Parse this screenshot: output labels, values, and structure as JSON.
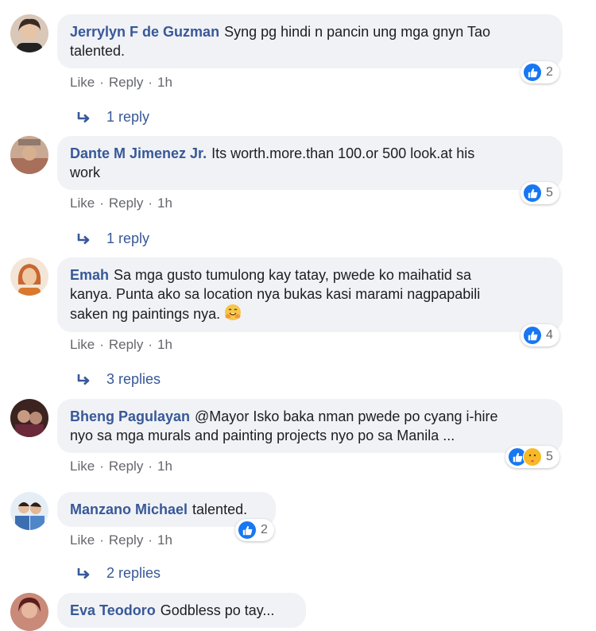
{
  "actions": {
    "like": "Like",
    "reply": "Reply",
    "sep": "·"
  },
  "colors": {
    "name": "#385898",
    "like_blue": "#1877f2",
    "bubble_bg": "#f0f2f5",
    "meta_gray": "#65676b"
  },
  "comments": [
    {
      "author": "Jerrylyn F de Guzman",
      "text_lines": [
        "Syng pg hindi n pancin ung mga gnyn Tao",
        "talented."
      ],
      "time": "1h",
      "reactions": {
        "types": [
          "like"
        ],
        "count": "2"
      },
      "replies": "1 reply"
    },
    {
      "author": "Dante M Jimenez Jr.",
      "text_lines": [
        "Its worth.more.than 100.or 500 look.at his",
        "work"
      ],
      "time": "1h",
      "reactions": {
        "types": [
          "like"
        ],
        "count": "5"
      },
      "replies": "1 reply"
    },
    {
      "author": "Emah",
      "text_lines": [
        "Sa mga gusto tumulong kay tatay, pwede ko maihatid sa",
        "kanya. Punta ako sa location nya bukas kasi marami nagpapabili",
        "saken ng paintings nya."
      ],
      "emoji": "hugging-face-emoji",
      "time": "1h",
      "reactions": {
        "types": [
          "like"
        ],
        "count": "4"
      },
      "replies": "3 replies"
    },
    {
      "author": "Bheng Pagulayan",
      "text_lines": [
        "@Mayor Isko baka nman pwede po cyang i-hire",
        "nyo sa mga murals and painting projects nyo po sa Manila ..."
      ],
      "time": "1h",
      "reactions": {
        "types": [
          "like",
          "care"
        ],
        "count": "5"
      },
      "replies": ""
    },
    {
      "author": "Manzano Michael",
      "text_lines": [
        "talented."
      ],
      "time": "1h",
      "reactions": {
        "types": [
          "like"
        ],
        "count": "2"
      },
      "replies": "2 replies"
    },
    {
      "author": "Eva Teodoro",
      "text_lines": [
        "Godbless po tay..."
      ],
      "time": "",
      "reactions": null,
      "replies": ""
    }
  ]
}
